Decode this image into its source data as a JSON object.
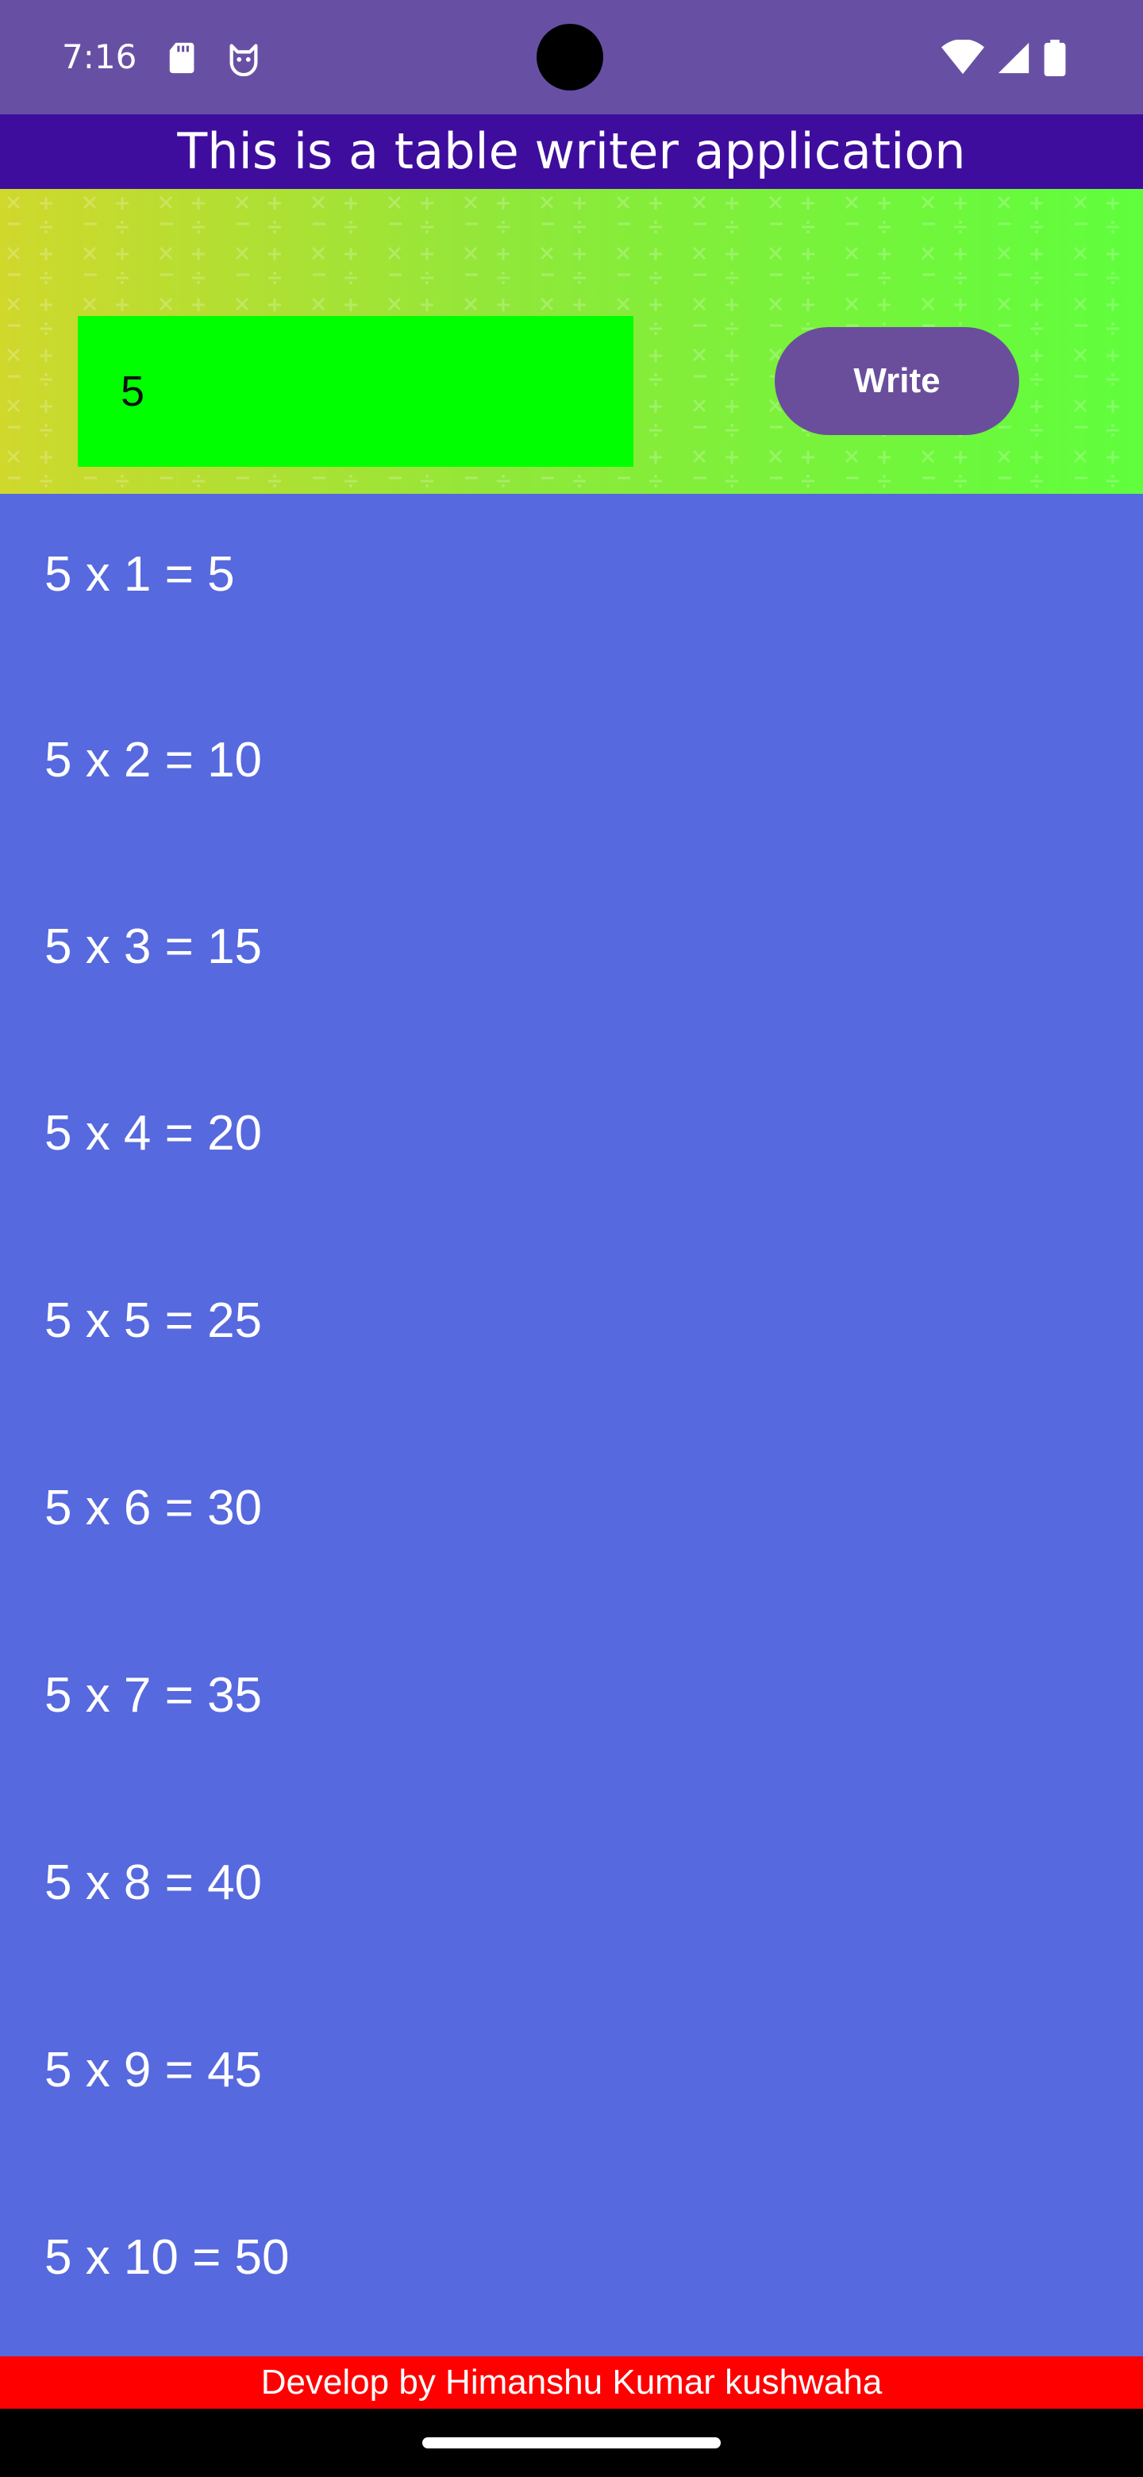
{
  "status_bar": {
    "time": "7:16",
    "left_icons": [
      "sd-card-icon",
      "cat-face-icon"
    ],
    "right_icons": [
      "wifi-icon",
      "signal-icon",
      "battery-icon"
    ]
  },
  "app": {
    "title": "This is a table writer application"
  },
  "input_panel": {
    "input_value": "5",
    "write_label": "Write"
  },
  "table": {
    "rows": [
      "5 x 1 = 5",
      "5 x 2 = 10",
      "5 x 3 = 15",
      "5 x 4 = 20",
      "5 x 5 = 25",
      "5 x 6 = 30",
      "5 x 7 = 35",
      "5 x 8 = 40",
      "5 x 9 = 45",
      "5 x 10 = 50"
    ]
  },
  "footer": {
    "text": "Develop by Himanshu Kumar kushwaha"
  },
  "colors": {
    "status_bar": "#6750a4",
    "title_bar": "#3f0d9e",
    "input_field": "#00ff00",
    "button": "#6a4e9c",
    "list_background": "#5669de",
    "footer": "#ff0000"
  }
}
